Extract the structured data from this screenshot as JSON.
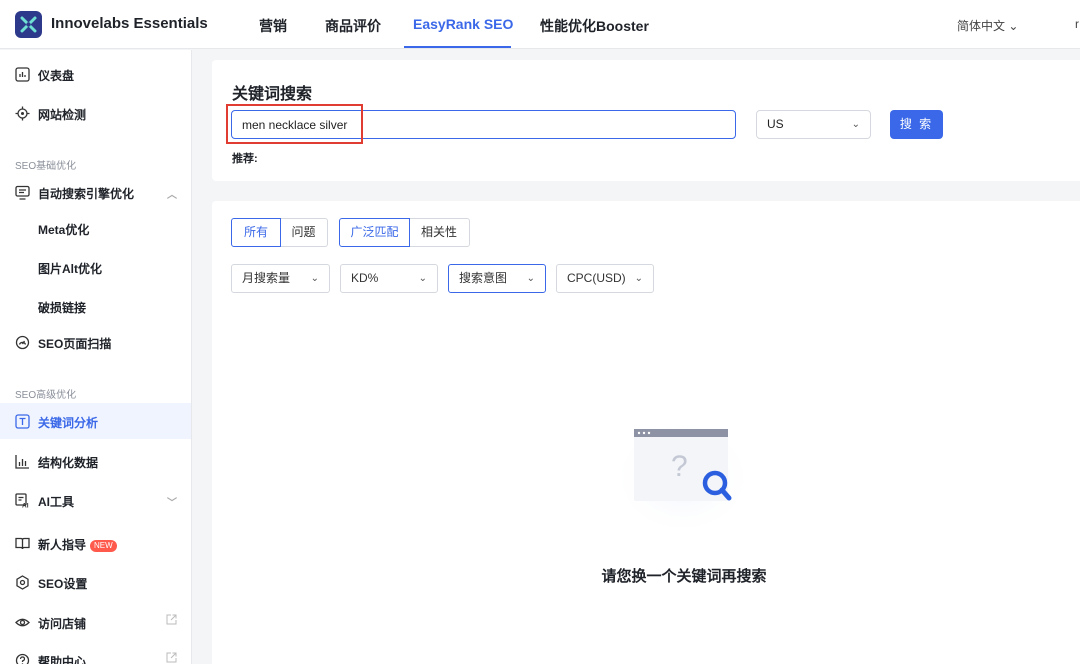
{
  "app": {
    "title": "Innovelabs Essentials"
  },
  "header": {
    "tabs": [
      {
        "label": "营销"
      },
      {
        "label": "商品评价"
      },
      {
        "label": "EasyRank SEO"
      },
      {
        "label": "性能优化Booster"
      }
    ],
    "active_tab": "EasyRank SEO",
    "language": "简体中文 ⌄",
    "user_fragment": "r"
  },
  "sidebar": {
    "items": [
      {
        "label": "仪表盘",
        "icon": "dashboard-icon"
      },
      {
        "label": "网站检测",
        "icon": "target-icon"
      },
      {
        "label": "自动搜索引擎优化",
        "icon": "monitor-icon"
      },
      {
        "label": "Meta优化"
      },
      {
        "label": "图片Alt优化"
      },
      {
        "label": "破损链接"
      },
      {
        "label": "SEO页面扫描",
        "icon": "gauge-icon"
      },
      {
        "label": "关键词分析",
        "icon": "keyword-icon"
      },
      {
        "label": "结构化数据",
        "icon": "bar-chart-icon"
      },
      {
        "label": "AI工具",
        "icon": "ai-icon"
      },
      {
        "label": "新人指导",
        "icon": "book-icon",
        "badge": "NEW"
      },
      {
        "label": "SEO设置",
        "icon": "settings-hex-icon"
      },
      {
        "label": "访问店铺",
        "icon": "eye-icon"
      },
      {
        "label": "帮助中心",
        "icon": "help-icon"
      }
    ],
    "sections": [
      "SEO基础优化",
      "SEO高级优化"
    ],
    "active_item": "关键词分析"
  },
  "search": {
    "title": "关键词搜索",
    "value": "men necklace silver",
    "country": "US",
    "button_label": "搜 索",
    "recommend_label": "推荐:"
  },
  "filters": {
    "type_tabs": [
      "所有",
      "问题"
    ],
    "match_tabs": [
      "广泛匹配",
      "相关性"
    ],
    "dropdowns": [
      "月搜索量",
      "KD%",
      "搜索意图",
      "CPC(USD)"
    ]
  },
  "empty_state": {
    "message": "请您换一个关键词再搜索"
  },
  "colors": {
    "accent": "#3a68e8",
    "highlight": "#e03c31",
    "badge": "#ff5a4c"
  }
}
